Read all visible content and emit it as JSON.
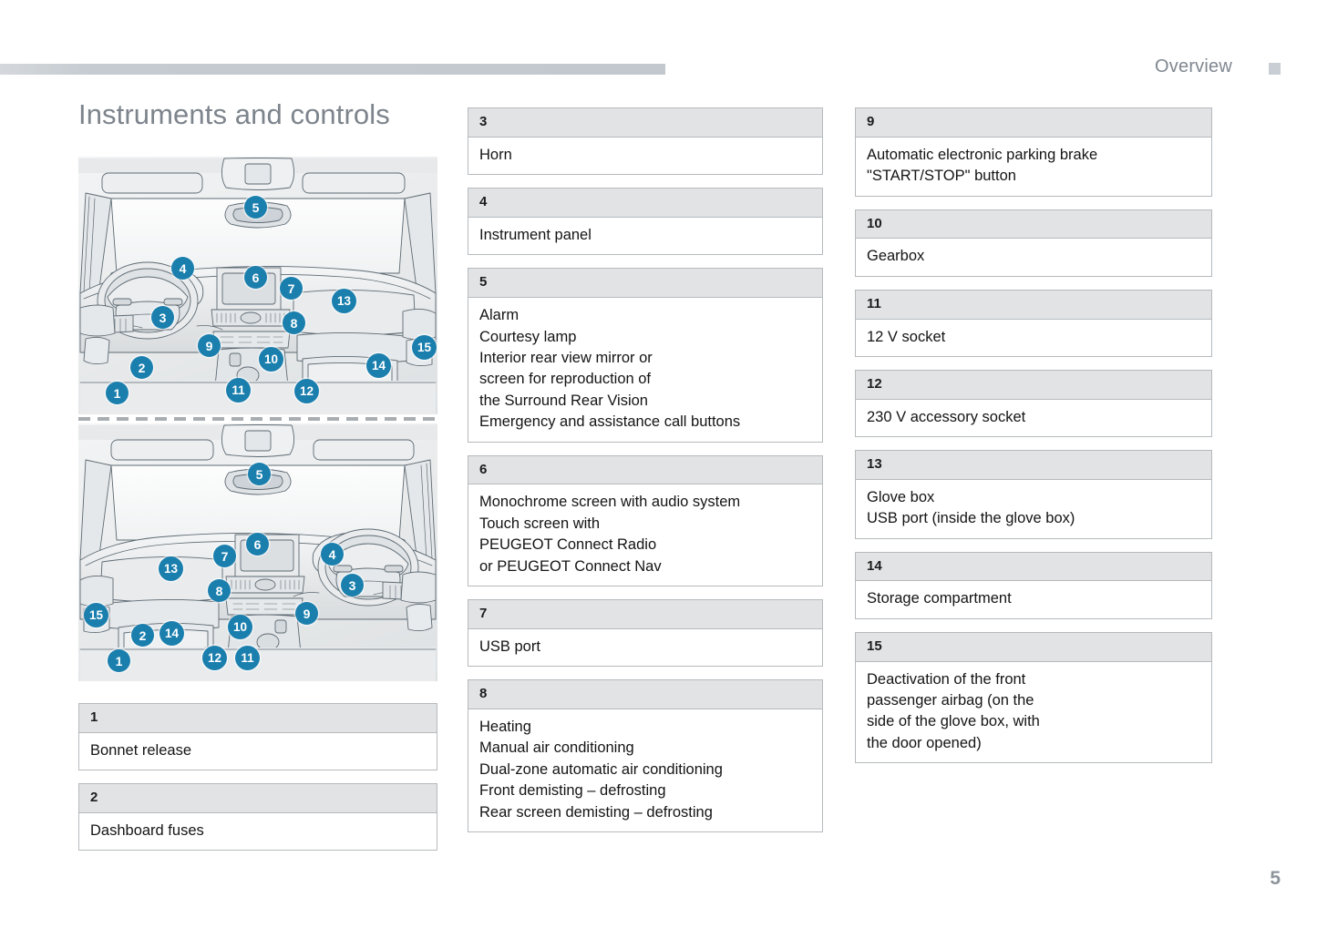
{
  "header": {
    "section_title": "Overview",
    "marker_icon": "section-square-marker"
  },
  "page_title": "Instruments and controls",
  "page_number": "5",
  "colors": {
    "badge_blue": "#1b7fae",
    "table_header_bg": "#e1e3e5",
    "table_border": "#b6babd",
    "header_bar": "#c5cbd1",
    "title_gray": "#7d848c"
  },
  "illustrations": [
    {
      "name": "dashboard-lhd",
      "caption": "Left-hand drive dashboard overview",
      "callouts": [
        "1",
        "2",
        "3",
        "4",
        "5",
        "6",
        "7",
        "8",
        "9",
        "10",
        "11",
        "12",
        "13",
        "14",
        "15"
      ]
    },
    {
      "name": "dashboard-rhd",
      "caption": "Right-hand drive dashboard overview",
      "callouts": [
        "1",
        "2",
        "3",
        "4",
        "5",
        "6",
        "7",
        "8",
        "9",
        "10",
        "11",
        "12",
        "13",
        "14",
        "15"
      ]
    }
  ],
  "columns": {
    "left": [
      {
        "num": "1",
        "lines": [
          "Bonnet release"
        ]
      },
      {
        "num": "2",
        "lines": [
          "Dashboard fuses"
        ]
      }
    ],
    "middle": [
      {
        "num": "3",
        "lines": [
          "Horn"
        ]
      },
      {
        "num": "4",
        "lines": [
          "Instrument panel"
        ]
      },
      {
        "num": "5",
        "lines": [
          "Alarm",
          "Courtesy lamp",
          "Interior rear view mirror or",
          "screen for reproduction of",
          "the Surround Rear Vision",
          "Emergency and assistance call buttons"
        ]
      },
      {
        "num": "6",
        "lines": [
          "Monochrome screen with audio system",
          "Touch screen with",
          "PEUGEOT Connect Radio",
          "or PEUGEOT Connect Nav"
        ]
      },
      {
        "num": "7",
        "lines": [
          "USB port"
        ]
      },
      {
        "num": "8",
        "lines": [
          "Heating",
          "Manual air conditioning",
          "Dual-zone automatic air conditioning",
          "Front demisting – defrosting",
          "Rear screen demisting – defrosting"
        ]
      }
    ],
    "right": [
      {
        "num": "9",
        "lines": [
          "Automatic electronic parking brake",
          "\"START/STOP\" button"
        ]
      },
      {
        "num": "10",
        "lines": [
          "Gearbox"
        ]
      },
      {
        "num": "11",
        "lines": [
          "12 V socket"
        ]
      },
      {
        "num": "12",
        "lines": [
          "230 V accessory socket"
        ]
      },
      {
        "num": "13",
        "lines": [
          "Glove box",
          "USB port (inside the glove box)"
        ]
      },
      {
        "num": "14",
        "lines": [
          "Storage compartment"
        ]
      },
      {
        "num": "15",
        "lines": [
          "Deactivation of the front",
          "passenger airbag (on the",
          "side of the glove box, with",
          "the door opened)"
        ]
      }
    ]
  }
}
